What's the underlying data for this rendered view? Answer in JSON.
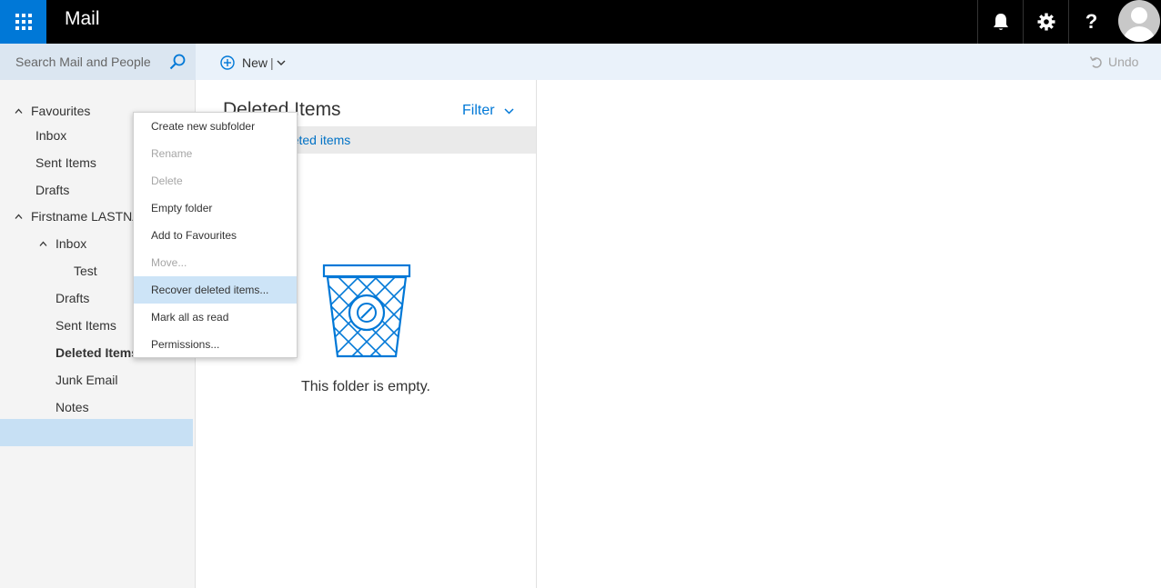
{
  "app": {
    "title": "Mail"
  },
  "topbar": {
    "waffle_icon": "app-launcher-icon",
    "notifications_icon": "bell-icon",
    "settings_icon": "gear-icon",
    "help_label": "?",
    "avatar_icon": "user-avatar-icon"
  },
  "search": {
    "placeholder": "Search Mail and People"
  },
  "toolbar": {
    "new_label": "New",
    "new_separator": "|",
    "undo_label": "Undo"
  },
  "nav": {
    "favourites_label": "Favourites",
    "favourites_items": [
      "Inbox",
      "Sent Items",
      "Drafts"
    ],
    "account_label": "Firstname LASTNA",
    "inbox_label": "Inbox",
    "inbox_children": [
      "Test"
    ],
    "folders": [
      "Drafts",
      "Sent Items",
      "Deleted Items",
      "Junk Email",
      "Notes"
    ],
    "selected": "Deleted Items"
  },
  "list": {
    "title": "Deleted Items",
    "filter_label": "Filter",
    "recover_link": "Recover deleted items",
    "empty_text": "This folder is empty."
  },
  "context_menu": {
    "items": [
      {
        "label": "Create new subfolder",
        "disabled": false
      },
      {
        "label": "Rename",
        "disabled": true
      },
      {
        "label": "Delete",
        "disabled": true
      },
      {
        "label": "Empty folder",
        "disabled": false
      },
      {
        "label": "Add to Favourites",
        "disabled": false
      },
      {
        "label": "Move...",
        "disabled": true
      },
      {
        "label": "Recover deleted items...",
        "disabled": false,
        "hovered": true
      },
      {
        "label": "Mark all as read",
        "disabled": false
      },
      {
        "label": "Permissions...",
        "disabled": false
      }
    ]
  },
  "colors": {
    "accent": "#0078d7",
    "selected_bg": "#c7e0f4",
    "menu_hover": "#cde4f7",
    "topbar": "#000000"
  }
}
